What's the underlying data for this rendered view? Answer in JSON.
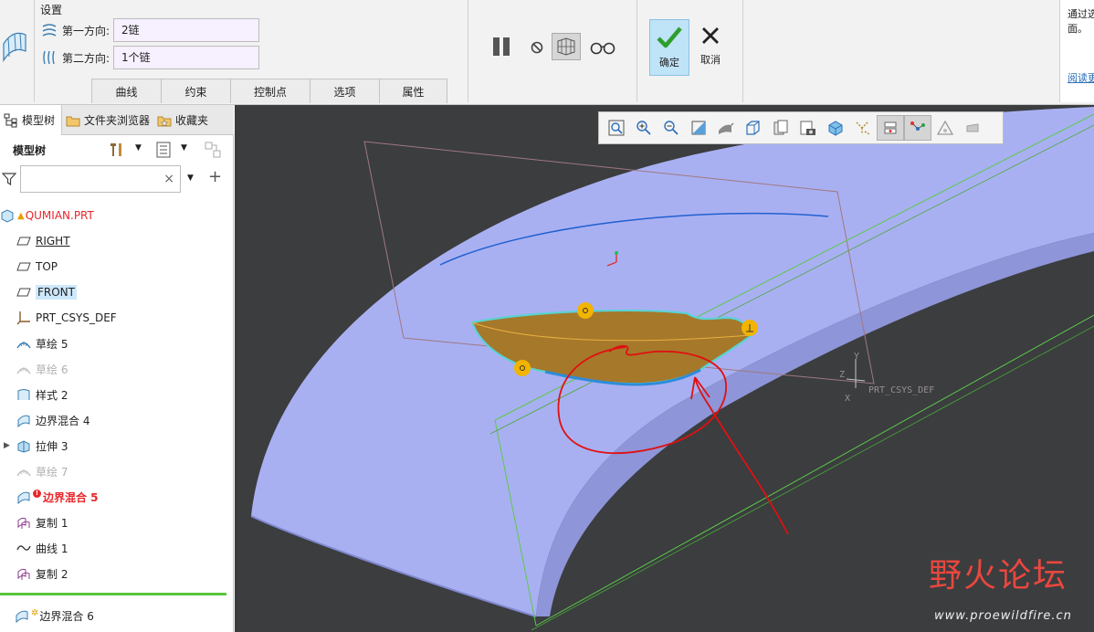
{
  "ribbon": {
    "group_title": "设置",
    "first_dir_label": "第一方向:",
    "first_dir_value": "2链",
    "second_dir_label": "第二方向:",
    "second_dir_value": "1个链",
    "tabs": [
      "曲线",
      "约束",
      "控制点",
      "选项",
      "属性"
    ],
    "ok_label": "确定",
    "cancel_label": "取消",
    "help_text_1": "通过选",
    "help_text_2": "面。",
    "help_link": "阅读更"
  },
  "panel": {
    "tabs": [
      {
        "label": "模型树",
        "icon": "model-tree-icon"
      },
      {
        "label": "文件夹浏览器",
        "icon": "folder-browser-icon"
      },
      {
        "label": "收藏夹",
        "icon": "favorites-icon"
      }
    ],
    "tree_title": "模型树",
    "search_placeholder": "",
    "search_clear": "×",
    "add": "+"
  },
  "tree": {
    "root": "QUMIAN.PRT",
    "items": [
      {
        "label": "RIGHT",
        "icon": "datum-plane-icon"
      },
      {
        "label": "TOP",
        "icon": "datum-plane-icon"
      },
      {
        "label": "FRONT",
        "icon": "datum-plane-icon"
      },
      {
        "label": "PRT_CSYS_DEF",
        "icon": "csys-icon"
      },
      {
        "label": "草绘 5",
        "icon": "sketch-icon"
      },
      {
        "label": "草绘 6",
        "icon": "sketch-icon"
      },
      {
        "label": "样式 2",
        "icon": "style-icon"
      },
      {
        "label": "边界混合 4",
        "icon": "boundary-blend-icon"
      },
      {
        "label": "拉伸 3",
        "icon": "extrude-icon"
      },
      {
        "label": "草绘 7",
        "icon": "sketch-icon"
      },
      {
        "label": "边界混合 5",
        "icon": "boundary-blend-icon"
      },
      {
        "label": "复制 1",
        "icon": "copy-icon"
      },
      {
        "label": "曲线 1",
        "icon": "curve-icon"
      },
      {
        "label": "复制 2",
        "icon": "copy-icon"
      }
    ],
    "after_insert": "边界混合 6"
  },
  "viewport": {
    "csys_label": "PRT_CSYS_DEF",
    "axis_y": "Y",
    "axis_z": "Z",
    "axis_x": "X",
    "watermark_title": "野火论坛",
    "watermark_url": "www.proewildfire.cn"
  },
  "colors": {
    "surface": "#a9b0f2",
    "background": "#3b3d3f",
    "patch": "#a6782a",
    "annotation": "#e01010",
    "accent_ok": "#bfe3f7"
  }
}
